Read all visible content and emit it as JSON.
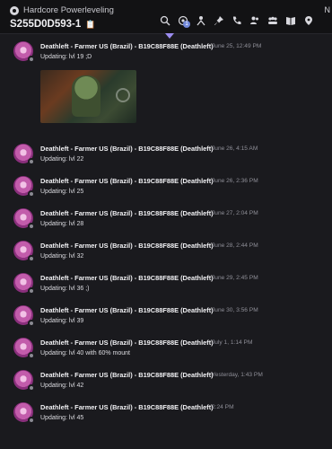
{
  "header": {
    "server_name": "Hardcore Powerleveling",
    "channel_name": "S255D0D593-1",
    "notification_count": "1",
    "edge_text": "N",
    "toolbar_icons": [
      "search-icon",
      "notifications-icon",
      "threads-icon",
      "pin-icon",
      "call-icon",
      "members-icon",
      "group-icon",
      "book-icon",
      "location-icon"
    ]
  },
  "messages": [
    {
      "author": "Deathleft - Farmer US (Brazil) - B19C88F88E (Deathleft)",
      "time": "June 25, 12:49 PM",
      "text": "Updating: lvl 19 ;D",
      "has_image": true
    },
    {
      "author": "Deathleft - Farmer US (Brazil) - B19C88F88E (Deathleft)",
      "time": "June 26, 4:15 AM",
      "text": "Updating: lvl 22"
    },
    {
      "author": "Deathleft - Farmer US (Brazil) - B19C88F88E (Deathleft)",
      "time": "June 26, 2:36 PM",
      "text": "Updating: lvl 25"
    },
    {
      "author": "Deathleft - Farmer US (Brazil) - B19C88F88E (Deathleft)",
      "time": "June 27, 2:04 PM",
      "text": "Updating: lvl 28"
    },
    {
      "author": "Deathleft - Farmer US (Brazil) - B19C88F88E (Deathleft)",
      "time": "June 28, 2:44 PM",
      "text": "Updating: lvl 32"
    },
    {
      "author": "Deathleft - Farmer US (Brazil) - B19C88F88E (Deathleft)",
      "time": "June 29, 2:45 PM",
      "text": "Updating: lvl 36 ;)"
    },
    {
      "author": "Deathleft - Farmer US (Brazil) - B19C88F88E (Deathleft)",
      "time": "June 30, 3:56 PM",
      "text": "Updating: lvl 39"
    },
    {
      "author": "Deathleft - Farmer US (Brazil) - B19C88F88E (Deathleft)",
      "time": "July 1, 1:14 PM",
      "text": "Updating: lvl 40 with 60% mount"
    },
    {
      "author": "Deathleft - Farmer US (Brazil) - B19C88F88E (Deathleft)",
      "time": "Yesterday, 1:43 PM",
      "text": "Updating: lvl 42"
    },
    {
      "author": "Deathleft - Farmer US (Brazil) - B19C88F88E (Deathleft)",
      "time": "2:24 PM",
      "text": "Updating: lvl 45"
    }
  ]
}
